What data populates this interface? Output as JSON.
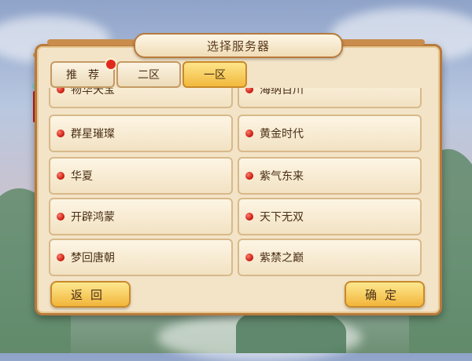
{
  "title": "选择服务器",
  "tabs": [
    {
      "label": "推　荐",
      "active": false,
      "has_badge": true
    },
    {
      "label": "二区",
      "active": false,
      "has_badge": false
    },
    {
      "label": "一区",
      "active": true,
      "has_badge": false
    }
  ],
  "servers": {
    "left": [
      "物华天宝",
      "群星璀璨",
      "华夏",
      "开辟鸿蒙",
      "梦回唐朝"
    ],
    "right": [
      "海纳百川",
      "黄金时代",
      "紫气东来",
      "天下无双",
      "紫禁之巅"
    ]
  },
  "buttons": {
    "back_label": "返回",
    "confirm_label": "确定"
  },
  "colors": {
    "accent": "#f2b53a",
    "panel": "#f3e4c8",
    "status_dot": "#d42a1d"
  }
}
